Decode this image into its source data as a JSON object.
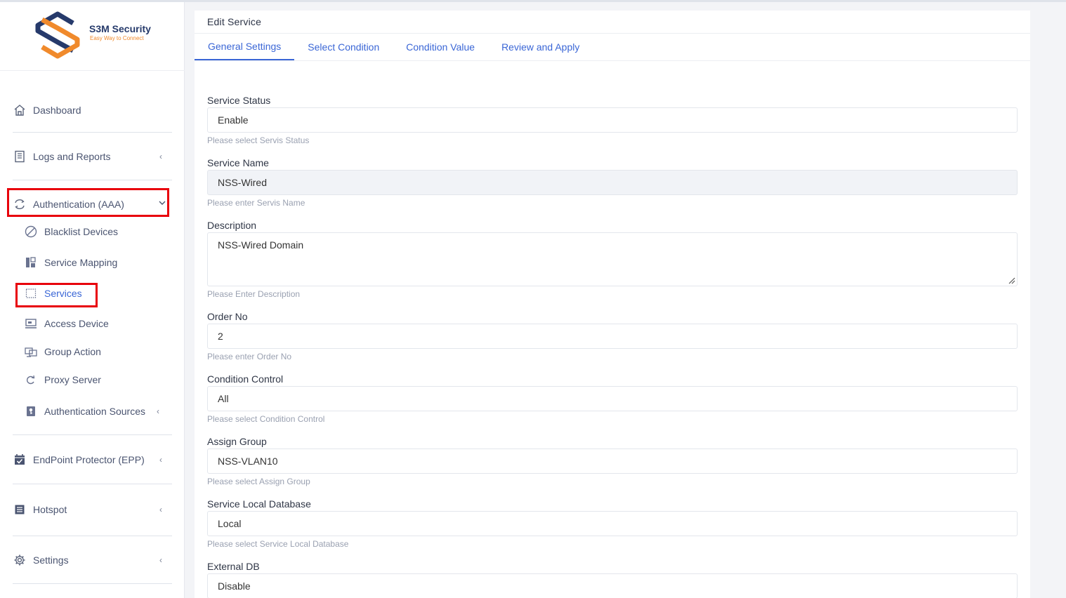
{
  "brand": {
    "name": "S3M Security",
    "tagline": "Easy Way to Connect",
    "primary_color": "#263a6b",
    "accent_color": "#f08a2c"
  },
  "sidebar": {
    "items": [
      {
        "label": "Dashboard",
        "icon": "home-icon"
      },
      {
        "label": "Logs and Reports",
        "icon": "report-icon"
      },
      {
        "label": "Authentication (AAA)",
        "icon": "sync-icon",
        "expanded": true,
        "children": [
          {
            "label": "Blacklist Devices",
            "icon": "ban-icon"
          },
          {
            "label": "Service Mapping",
            "icon": "mapping-icon"
          },
          {
            "label": "Services",
            "icon": "dashed-square-icon",
            "active": true
          },
          {
            "label": "Access Device",
            "icon": "device-icon"
          },
          {
            "label": "Group Action",
            "icon": "group-icon"
          },
          {
            "label": "Proxy Server",
            "icon": "redo-icon"
          },
          {
            "label": "Authentication Sources",
            "icon": "key-icon"
          }
        ]
      },
      {
        "label": "EndPoint Protector (EPP)",
        "icon": "calendar-check-icon"
      },
      {
        "label": "Hotspot",
        "icon": "list-icon"
      },
      {
        "label": "Settings",
        "icon": "gear-icon"
      }
    ]
  },
  "page": {
    "title": "Edit Service",
    "tabs": [
      "General Settings",
      "Select Condition",
      "Condition Value",
      "Review and Apply"
    ],
    "active_tab": "General Settings"
  },
  "form": {
    "service_status": {
      "label": "Service Status",
      "value": "Enable",
      "hint": "Please select Servis Status"
    },
    "service_name": {
      "label": "Service Name",
      "value": "NSS-Wired",
      "hint": "Please enter Servis Name"
    },
    "description": {
      "label": "Description",
      "value": "NSS-Wired Domain",
      "hint": "Please Enter Description"
    },
    "order_no": {
      "label": "Order No",
      "value": "2",
      "hint": "Please enter Order No"
    },
    "condition_control": {
      "label": "Condition Control",
      "value": "All",
      "hint": "Please select Condition Control"
    },
    "assign_group": {
      "label": "Assign Group",
      "value": "NSS-VLAN10",
      "hint": "Please select Assign Group"
    },
    "local_database": {
      "label": "Service Local Database",
      "value": "Local",
      "hint": "Please select Service Local Database"
    },
    "external_db": {
      "label": "External DB",
      "value": "Disable"
    }
  },
  "colors": {
    "link": "#3a66d6",
    "highlight": "#e8000b"
  }
}
